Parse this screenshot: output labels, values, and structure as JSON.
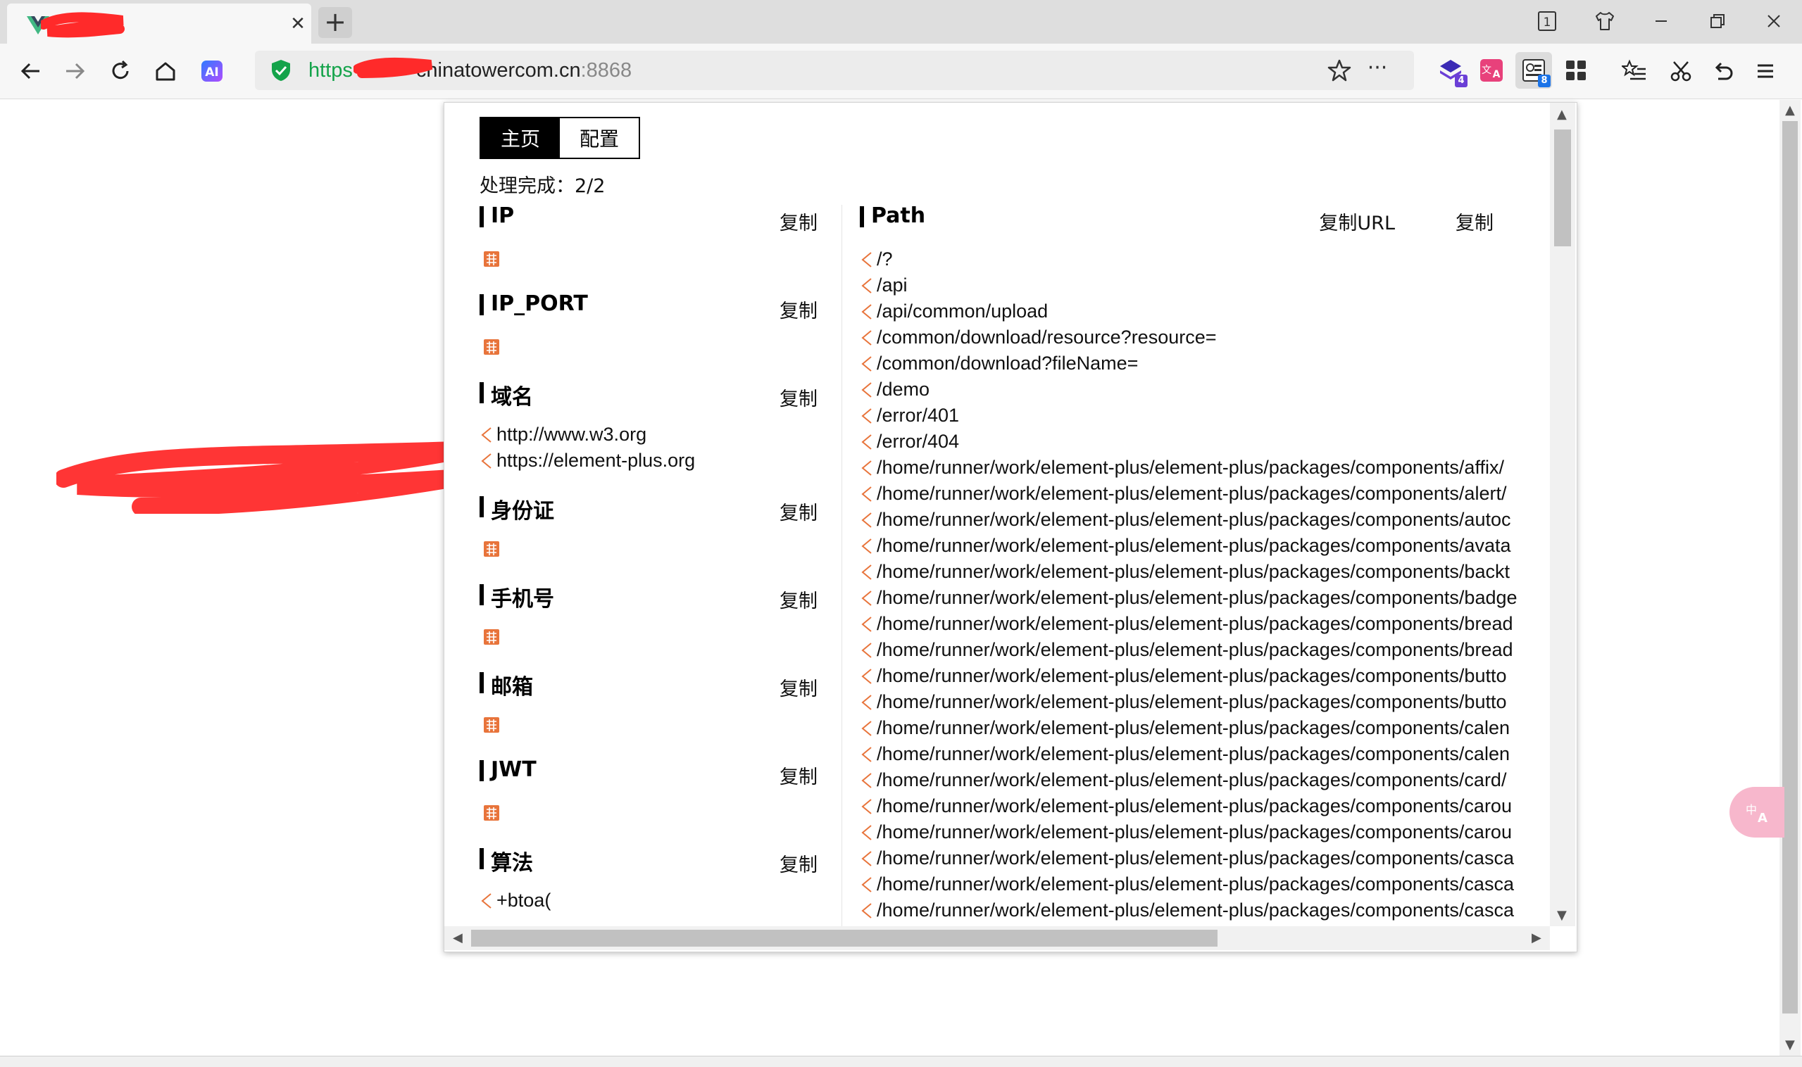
{
  "browser": {
    "tab_close_glyph": "✕",
    "new_tab_glyph": "+",
    "address": {
      "url_scheme": "https",
      "url_host": "chinatowercom.cn",
      "url_port": ":8868",
      "more_glyph": "···"
    },
    "extensions": [
      {
        "name": "ext-stack",
        "badge": "4",
        "badge_color": "#6b3fd6"
      },
      {
        "name": "ext-translate"
      },
      {
        "name": "ext-finder",
        "badge": "8",
        "badge_color": "#1a73e8"
      },
      {
        "name": "ext-grid"
      }
    ],
    "page_tab_counter": "1"
  },
  "finder_popup": {
    "tabs": [
      {
        "label": "主页",
        "active": true
      },
      {
        "label": "配置",
        "active": false
      }
    ],
    "status": "处理完成：2/2",
    "sections": [
      {
        "title": "IP",
        "copy_label": "复制",
        "items": []
      },
      {
        "title": "IP_PORT",
        "copy_label": "复制",
        "items": []
      },
      {
        "title": "域名",
        "copy_label": "复制",
        "items": [
          "http://www.w3.org",
          "https://element-plus.org"
        ]
      },
      {
        "title": "身份证",
        "copy_label": "复制",
        "items": []
      },
      {
        "title": "手机号",
        "copy_label": "复制",
        "items": []
      },
      {
        "title": "邮箱",
        "copy_label": "复制",
        "items": []
      },
      {
        "title": "JWT",
        "copy_label": "复制",
        "items": []
      },
      {
        "title": "算法",
        "copy_label": "复制",
        "items": [
          "+btoa("
        ]
      }
    ],
    "path_section": {
      "title": "Path",
      "copy_url_label": "复制URL",
      "copy_label": "复制",
      "items": [
        "/?",
        "/api",
        "/api/common/upload",
        "/common/download/resource?resource=",
        "/common/download?fileName=",
        "/demo",
        "/error/401",
        "/error/404",
        "/home/runner/work/element-plus/element-plus/packages/components/affix/",
        "/home/runner/work/element-plus/element-plus/packages/components/alert/",
        "/home/runner/work/element-plus/element-plus/packages/components/autoc",
        "/home/runner/work/element-plus/element-plus/packages/components/avata",
        "/home/runner/work/element-plus/element-plus/packages/components/backt",
        "/home/runner/work/element-plus/element-plus/packages/components/badge",
        "/home/runner/work/element-plus/element-plus/packages/components/bread",
        "/home/runner/work/element-plus/element-plus/packages/components/bread",
        "/home/runner/work/element-plus/element-plus/packages/components/butto",
        "/home/runner/work/element-plus/element-plus/packages/components/butto",
        "/home/runner/work/element-plus/element-plus/packages/components/calen",
        "/home/runner/work/element-plus/element-plus/packages/components/calen",
        "/home/runner/work/element-plus/element-plus/packages/components/card/",
        "/home/runner/work/element-plus/element-plus/packages/components/carou",
        "/home/runner/work/element-plus/element-plus/packages/components/carou",
        "/home/runner/work/element-plus/element-plus/packages/components/casca",
        "/home/runner/work/element-plus/element-plus/packages/components/casca",
        "/home/runner/work/element-plus/element-plus/packages/components/casca"
      ]
    }
  },
  "colors": {
    "accent_orange": "#e8743b",
    "secure_green": "#14a34a",
    "redaction_red": "#ff2a2a"
  }
}
